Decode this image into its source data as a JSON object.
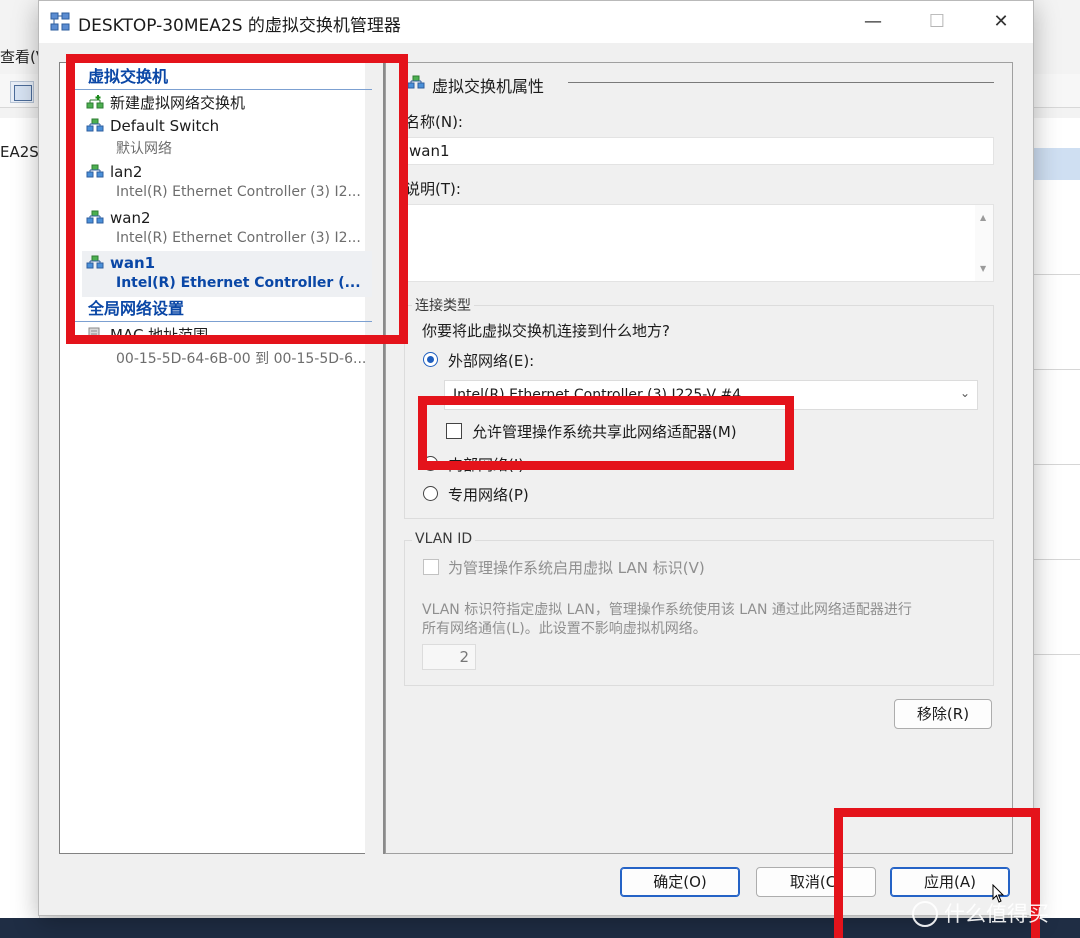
{
  "background_app": {
    "menu_fragment": "查看(V",
    "node_fragment": "EA2S"
  },
  "window": {
    "title": "DESKTOP-30MEA2S 的虚拟交换机管理器",
    "minimize": "—",
    "maximize": "☐",
    "close": "✕"
  },
  "tree": {
    "section_switches": "虚拟交换机",
    "items": [
      {
        "name": "新建虚拟网络交换机",
        "sub": ""
      },
      {
        "name": "Default Switch",
        "sub": "默认网络"
      },
      {
        "name": "lan2",
        "sub": "Intel(R) Ethernet Controller (3) I2..."
      },
      {
        "name": "wan2",
        "sub": "Intel(R) Ethernet Controller (3) I2..."
      },
      {
        "name": "wan1",
        "sub": "Intel(R) Ethernet Controller (..."
      }
    ],
    "selected_index": 4,
    "section_global": "全局网络设置",
    "mac_item": {
      "name": "MAC 地址范围",
      "sub": "00-15-5D-64-6B-00 到 00-15-5D-6..."
    }
  },
  "properties": {
    "title": "虚拟交换机属性",
    "name_label": "名称(N):",
    "name_value": "wan1",
    "notes_label": "说明(T):",
    "notes_value": "",
    "connection_group": "连接类型",
    "connection_question": "你要将此虚拟交换机连接到什么地方?",
    "radio_external": "外部网络(E):",
    "adapter_value": "Intel(R) Ethernet Controller (3) I225-V #4",
    "share_checkbox": "允许管理操作系统共享此网络适配器(M)",
    "radio_internal": "内部网络(I)",
    "radio_private": "专用网络(P)",
    "vlan_group": "VLAN ID",
    "vlan_checkbox": "为管理操作系统启用虚拟 LAN 标识(V)",
    "vlan_desc_line1": "VLAN 标识符指定虚拟 LAN，管理操作系统使用该 LAN 通过此网络适配器进行",
    "vlan_desc_line2": "所有网络通信(L)。此设置不影响虚拟机网络。",
    "vlan_value": "2",
    "remove_button": "移除(R)"
  },
  "buttons": {
    "ok": "确定(O)",
    "cancel": "取消(C)",
    "apply": "应用(A)"
  },
  "watermark": "什么值得买",
  "colors": {
    "annotation_red": "#e4131b",
    "section_blue": "#0a47a6",
    "accent_blue": "#1f5fbf"
  }
}
